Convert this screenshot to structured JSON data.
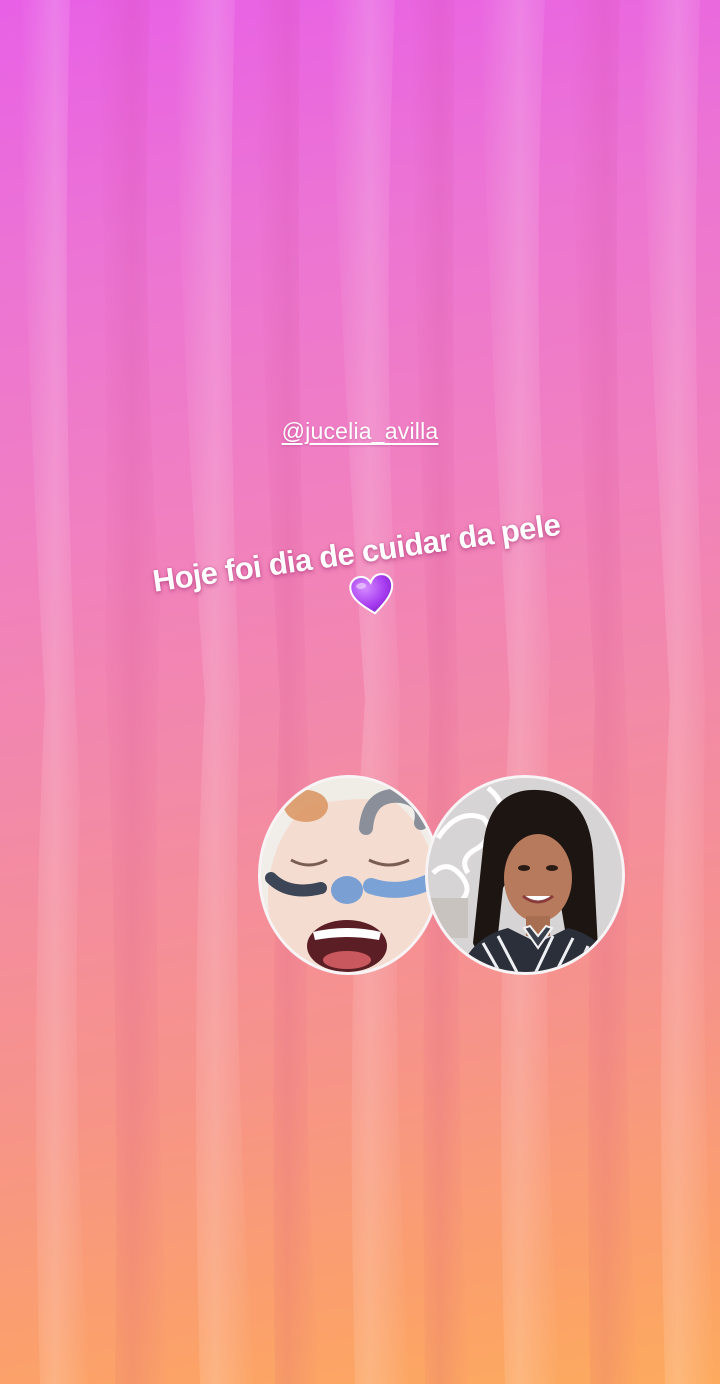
{
  "story": {
    "mention": "@jucelia_avilla",
    "caption": "Hoje foi dia de cuidar da pele",
    "heart_icon": "purple-heart-icon",
    "heart_color": "#a63cf0"
  },
  "photos": [
    {
      "name": "face-mask-photo",
      "description_icon": "photo-icon"
    },
    {
      "name": "profile-photo",
      "description_icon": "photo-icon"
    }
  ],
  "colors": {
    "gradient_top": "#e860e6",
    "gradient_bottom": "#fdaa5e"
  }
}
